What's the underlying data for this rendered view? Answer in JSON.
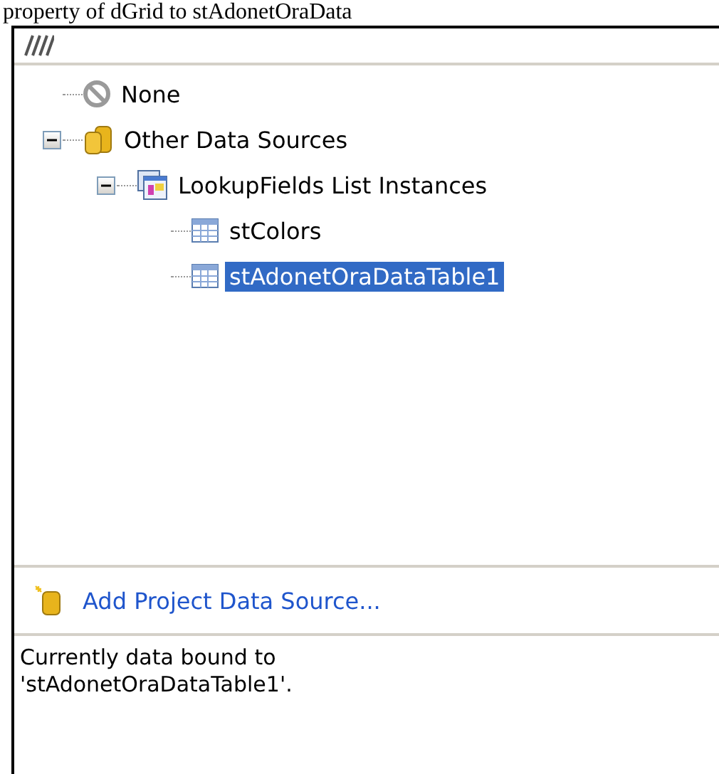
{
  "caption": "property of dGrid to stAdonetOraData",
  "tree": [
    {
      "label": "None",
      "kind": "none",
      "selected": false
    },
    {
      "label": "Other Data Sources",
      "kind": "database",
      "selected": false,
      "expanded": true,
      "children": [
        {
          "label": "LookupFields List Instances",
          "kind": "list",
          "selected": false,
          "expanded": true,
          "children": [
            {
              "label": "stColors",
              "kind": "table",
              "selected": false
            },
            {
              "label": "stAdonetOraDataTable1",
              "kind": "table",
              "selected": true
            }
          ]
        }
      ]
    }
  ],
  "add_link": "Add Project Data Source...",
  "description": "Currently data bound to 'stAdonetOraDataTable1'."
}
